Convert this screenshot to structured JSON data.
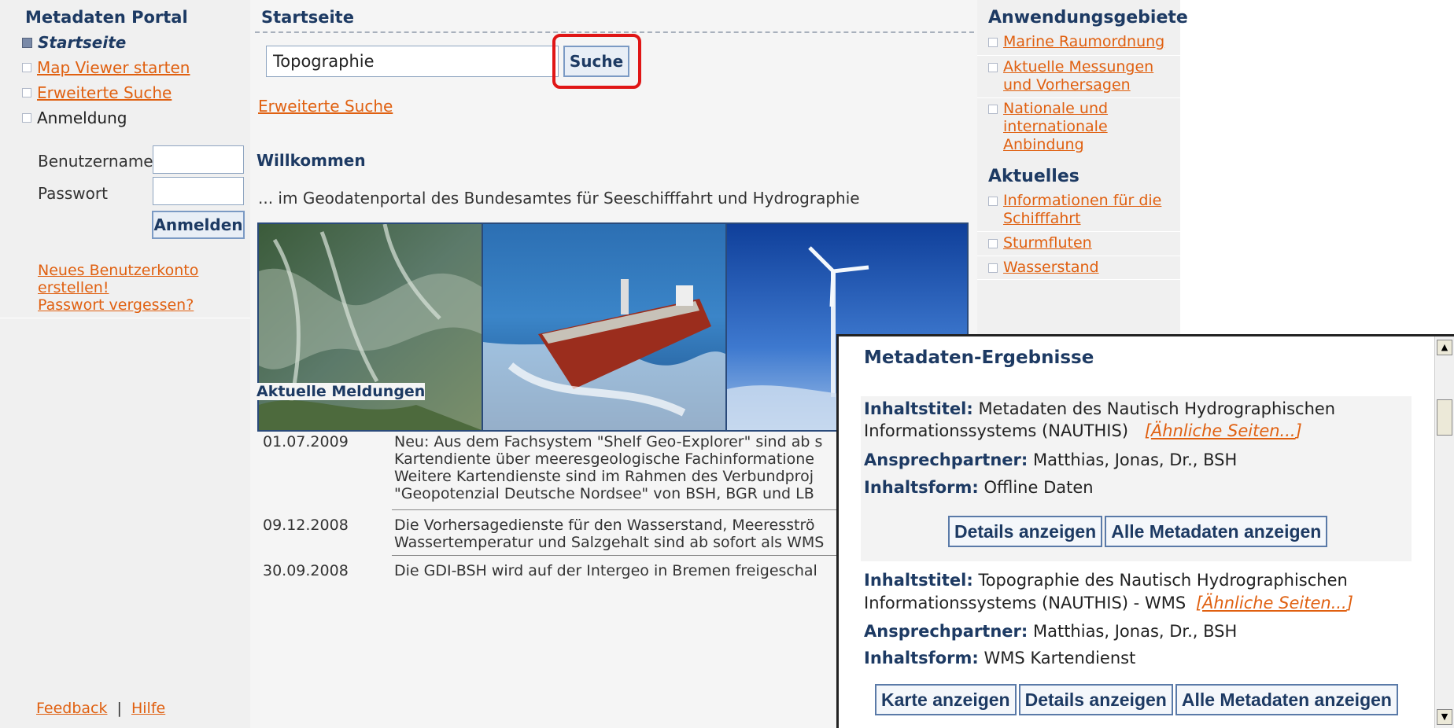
{
  "left": {
    "title": "Metadaten Portal",
    "nav": [
      {
        "label": "Startseite"
      },
      {
        "label": "Map Viewer starten"
      },
      {
        "label": "Erweiterte Suche"
      },
      {
        "label": "Anmeldung"
      }
    ],
    "username_label": "Benutzername",
    "password_label": "Passwort",
    "login_button": "Anmelden",
    "links": [
      "Neues Benutzerkonto",
      "erstellen!",
      "Passwort vergessen?"
    ],
    "footer_feedback": "Feedback",
    "footer_sep": "|",
    "footer_help": "Hilfe"
  },
  "center": {
    "breadcrumb": "Startseite",
    "search_value": "Topographie",
    "search_button": "Suche",
    "advanced_link": "Erweiterte Suche",
    "welcome_heading": "Willkommen",
    "welcome_text": "... im Geodatenportal des Bundesamtes für Seeschifffahrt und Hydrographie",
    "news_heading": "Aktuelle Meldungen",
    "news": [
      {
        "date": "01.07.2009",
        "text": "Neu: Aus dem Fachsystem \"Shelf Geo-Explorer\" sind ab s\nKartendiente über meeresgeologische Fachinformatione\nWeitere Kartendienste sind im Rahmen des Verbundproj\n\"Geopotenzial Deutsche Nordsee\" von BSH, BGR und LB"
      },
      {
        "date": "09.12.2008",
        "text": "Die Vorhersagedienste für den Wasserstand, Meeresströ\nWassertemperatur und Salzgehalt sind ab sofort als WMS"
      },
      {
        "date": "30.09.2008",
        "text": "Die GDI-BSH wird auf der Intergeo in Bremen freigeschal"
      }
    ]
  },
  "right": {
    "heading1": "Anwendungsgebiete",
    "items1": [
      "Marine Raumordnung",
      "Aktuelle Messungen\nund Vorhersagen",
      "Nationale und\ninternationale\nAnbindung"
    ],
    "heading2": "Aktuelles",
    "items2": [
      "Informationen für die\nSchifffahrt",
      "Sturmfluten",
      "Wasserstand"
    ]
  },
  "popup": {
    "title": "Metadaten-Ergebnisse",
    "labels": {
      "title": "Inhaltstitel:",
      "contact": "Ansprechpartner:",
      "form": "Inhaltsform:"
    },
    "similar": "Ähnliche Seiten...",
    "results": [
      {
        "title_line1": "Metadaten des Nautisch Hydrographischen",
        "title_line2": "Informationssystems (NAUTHIS)",
        "contact": "Matthias, Jonas, Dr., BSH",
        "form": "Offline Daten",
        "buttons": [
          "Details anzeigen",
          "Alle Metadaten anzeigen"
        ]
      },
      {
        "title_line1": "Topographie des Nautisch Hydrographischen",
        "title_line2": "Informationssystems (NAUTHIS) - WMS",
        "contact": "Matthias, Jonas, Dr., BSH",
        "form": "WMS Kartendienst",
        "buttons": [
          "Karte anzeigen",
          "Details anzeigen",
          "Alle Metadaten anzeigen"
        ]
      }
    ]
  }
}
